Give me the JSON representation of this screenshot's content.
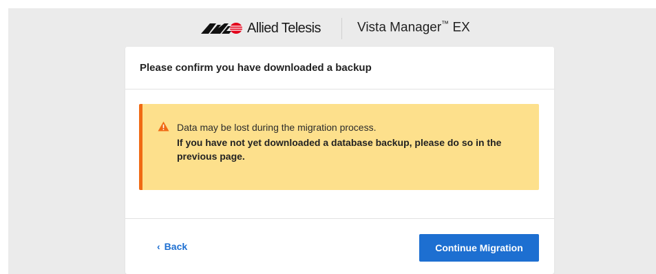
{
  "brand": {
    "company_name": "Allied Telesis",
    "product_name": "Vista Manager",
    "product_tm": "™",
    "product_suffix": " EX"
  },
  "dialog": {
    "title": "Please confirm you have downloaded a backup",
    "alert": {
      "icon": "warning-triangle-icon",
      "message": "Data may be lost during the migration process.",
      "instruction": "If you have not yet downloaded a database backup, please do so in the previous page."
    },
    "footer": {
      "back_label": "Back",
      "back_icon": "chevron-left-icon",
      "continue_label": "Continue Migration"
    }
  },
  "colors": {
    "background": "#ebebeb",
    "alert_background": "#fde08c",
    "alert_accent": "#f06a14",
    "primary": "#1d6fd1",
    "brand_red": "#e2001a"
  }
}
